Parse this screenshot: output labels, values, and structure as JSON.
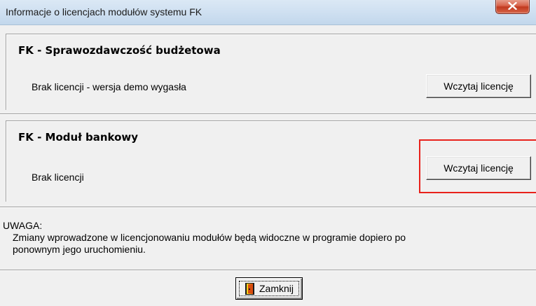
{
  "window": {
    "title": "Informacje o licencjach modułów systemu FK",
    "close_icon": "x-icon"
  },
  "modules": [
    {
      "title": "FK - Sprawozdawczość budżetowa",
      "status": "Brak licencji - wersja demo wygasła",
      "button_label": "Wczytaj licencję"
    },
    {
      "title": "FK - Moduł bankowy",
      "status": "Brak licencji",
      "button_label": "Wczytaj licencję"
    }
  ],
  "notice": {
    "title": "UWAGA:",
    "body": "Zmiany wprowadzone w licencjonowaniu modułów będą widoczne w programie dopiero po ponownym jego uruchomieniu."
  },
  "footer": {
    "close_label": "Zamknij",
    "close_icon": "door-exit-icon"
  },
  "colors": {
    "highlight": "#e8211b",
    "titlebar": "#cfe0f1",
    "background": "#f0f0f0"
  }
}
